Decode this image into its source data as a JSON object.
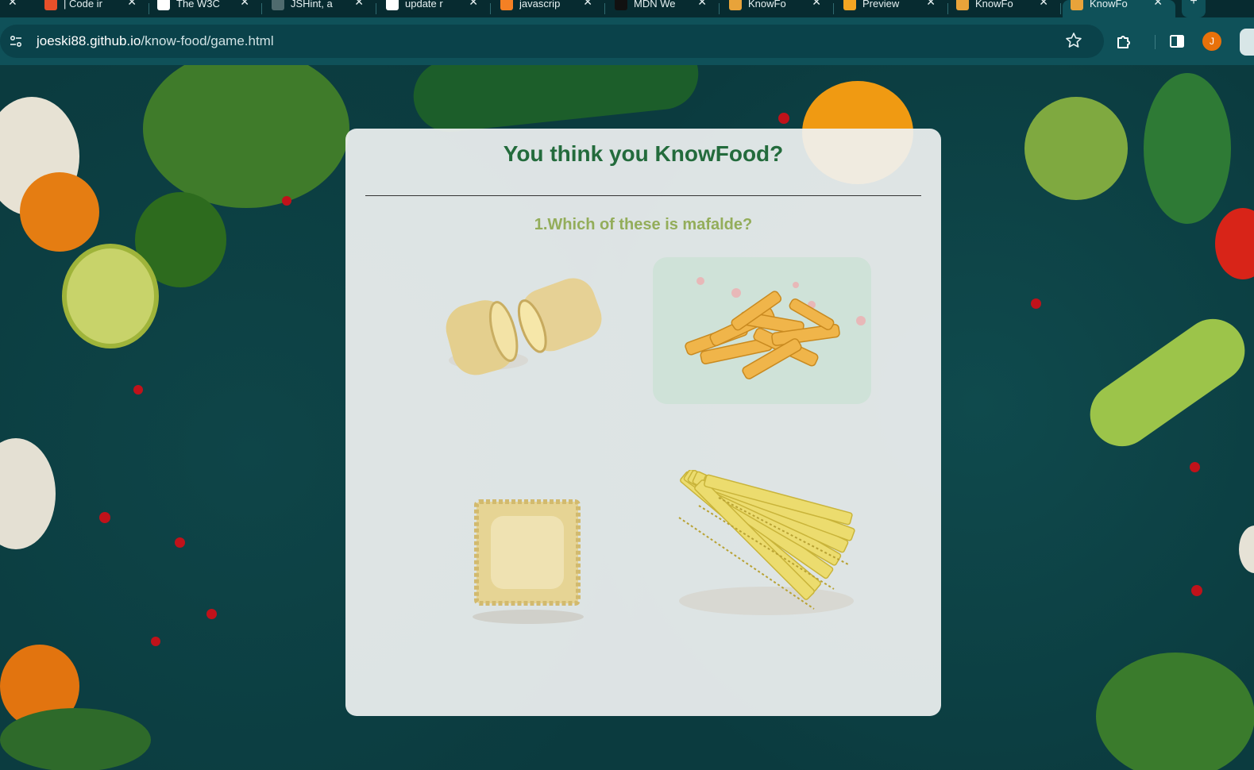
{
  "browser": {
    "tabs": [
      {
        "label": "| Code ir",
        "icon": "code-institute-icon",
        "color": "#e8502a",
        "active": false
      },
      {
        "label": "The W3C",
        "icon": "w3c-icon",
        "color": "#ffffff",
        "active": false
      },
      {
        "label": "JSHint, a",
        "icon": "jshint-icon",
        "color": "#4f6b6e",
        "active": false
      },
      {
        "label": "update r",
        "icon": "github-icon",
        "color": "#ffffff",
        "active": false
      },
      {
        "label": "javascrip",
        "icon": "stackoverflow-icon",
        "color": "#f48024",
        "active": false
      },
      {
        "label": "MDN We",
        "icon": "mdn-icon",
        "color": "#111111",
        "active": false
      },
      {
        "label": "KnowFo",
        "icon": "burger-icon",
        "color": "#e8a33a",
        "active": false
      },
      {
        "label": "Preview",
        "icon": "codeanywhere-icon",
        "color": "#f5a623",
        "active": false
      },
      {
        "label": "KnowFo",
        "icon": "burger-icon",
        "color": "#e8a33a",
        "active": false
      },
      {
        "label": "KnowFo",
        "icon": "burger-icon",
        "color": "#e8a33a",
        "active": true
      }
    ],
    "url_host": "joeski88.github.io",
    "url_path": "/know-food/game.html",
    "avatar_initial": "J"
  },
  "game": {
    "title": "You think you KnowFood?",
    "question": "1.Which of these is mafalde?",
    "choices": [
      {
        "name": "paccheri-image",
        "highlighted": false
      },
      {
        "name": "penne-image",
        "highlighted": true
      },
      {
        "name": "ravioli-image",
        "highlighted": false
      },
      {
        "name": "mafalde-image",
        "highlighted": false
      }
    ]
  },
  "colors": {
    "title": "#236b3c",
    "question": "#93ad5a",
    "chrome": "#0f5159",
    "background": "#0b3b3f"
  }
}
